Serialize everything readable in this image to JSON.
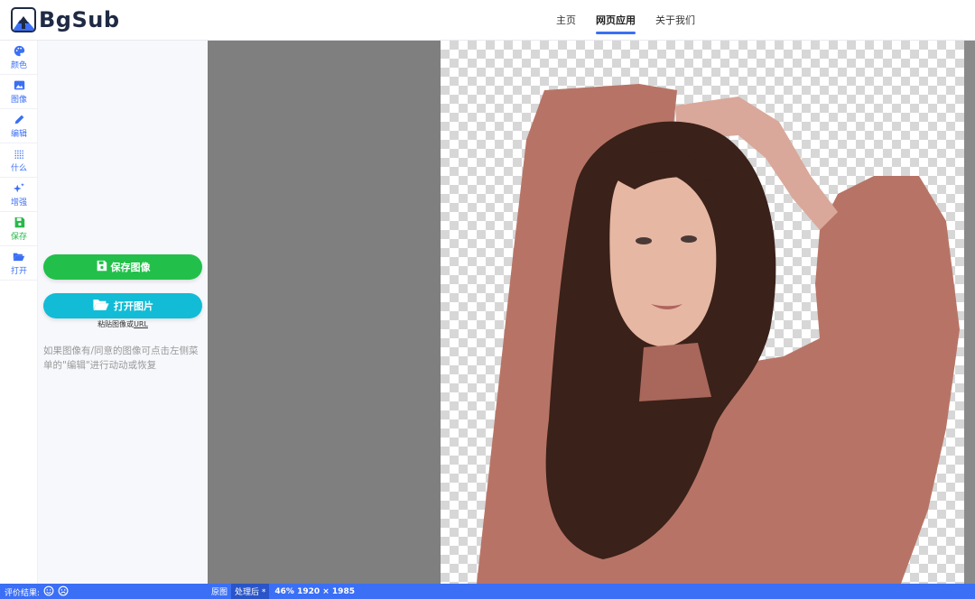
{
  "app": {
    "logo_text": "BgSub"
  },
  "nav": [
    {
      "label": "主页",
      "active": false
    },
    {
      "label": "网页应用",
      "active": true
    },
    {
      "label": "关于我们",
      "active": false
    }
  ],
  "rail": [
    {
      "label": "颜色",
      "icon": "palette-icon"
    },
    {
      "label": "图像",
      "icon": "image-icon"
    },
    {
      "label": "编辑",
      "icon": "pencil-icon"
    },
    {
      "label": "什么",
      "icon": "grid-dots-icon"
    },
    {
      "label": "增强",
      "icon": "sparkles-icon"
    },
    {
      "label": "保存",
      "icon": "floppy-icon"
    },
    {
      "label": "打开",
      "icon": "folder-open-icon"
    }
  ],
  "panel": {
    "save_button": "保存图像",
    "open_button": "打开图片",
    "paste_prefix": "粘贴图像或",
    "paste_url": "URL",
    "hint": "如果图像有/同意的图像可点击左侧菜单的\"编辑\"进行动动或恢复"
  },
  "status": {
    "rating_label": "评价结果:",
    "tab_original": "原图",
    "tab_processed": "处理后 *",
    "image_info": "46% 1920 × 1985"
  },
  "colors": {
    "accent": "#3b6ff5",
    "save_green": "#22c04a",
    "open_cyan": "#12bcd6"
  }
}
